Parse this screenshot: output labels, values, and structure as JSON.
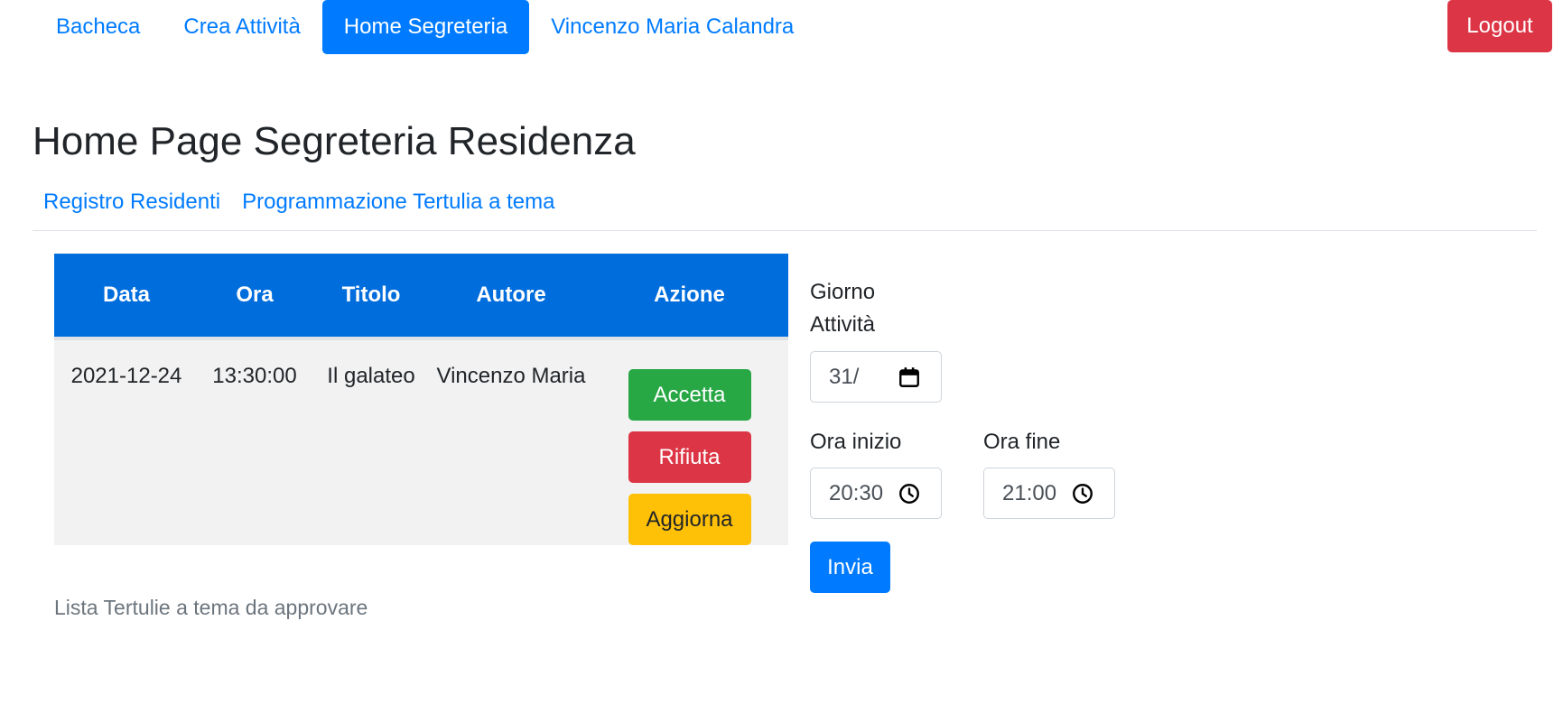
{
  "nav": {
    "items": [
      {
        "label": "Bacheca"
      },
      {
        "label": "Crea Attività"
      },
      {
        "label": "Home Segreteria"
      },
      {
        "label": "Vincenzo Maria Calandra"
      }
    ],
    "active_index": 2,
    "logout_label": "Logout"
  },
  "page": {
    "title": "Home Page Segreteria Residenza",
    "subnav": [
      {
        "label": "Registro Residenti"
      },
      {
        "label": "Programmazione Tertulia a tema"
      }
    ]
  },
  "table": {
    "headers": [
      "Data",
      "Ora",
      "Titolo",
      "Autore",
      "Azione"
    ],
    "rows": [
      {
        "data": "2021-12-24",
        "ora": "13:30:00",
        "titolo": "Il galateo",
        "autore": "Vincenzo Maria"
      }
    ],
    "actions": {
      "accept": "Accetta",
      "reject": "Rifiuta",
      "update": "Aggiorna"
    },
    "caption": "Lista Tertulie a tema da approvare"
  },
  "form": {
    "day_label_line1": "Giorno",
    "day_label_line2": "Attività",
    "day_value": "31/",
    "start_label": "Ora inizio",
    "start_value": "20:30",
    "end_label": "Ora fine",
    "end_value": "21:00",
    "submit_label": "Invia"
  },
  "colors": {
    "primary": "#007bff",
    "table_header": "#006ddd",
    "success": "#28a745",
    "danger": "#dc3545",
    "warning": "#ffc107"
  },
  "icons": {
    "date_picker": "calendar-icon",
    "time_picker": "clock-icon"
  }
}
